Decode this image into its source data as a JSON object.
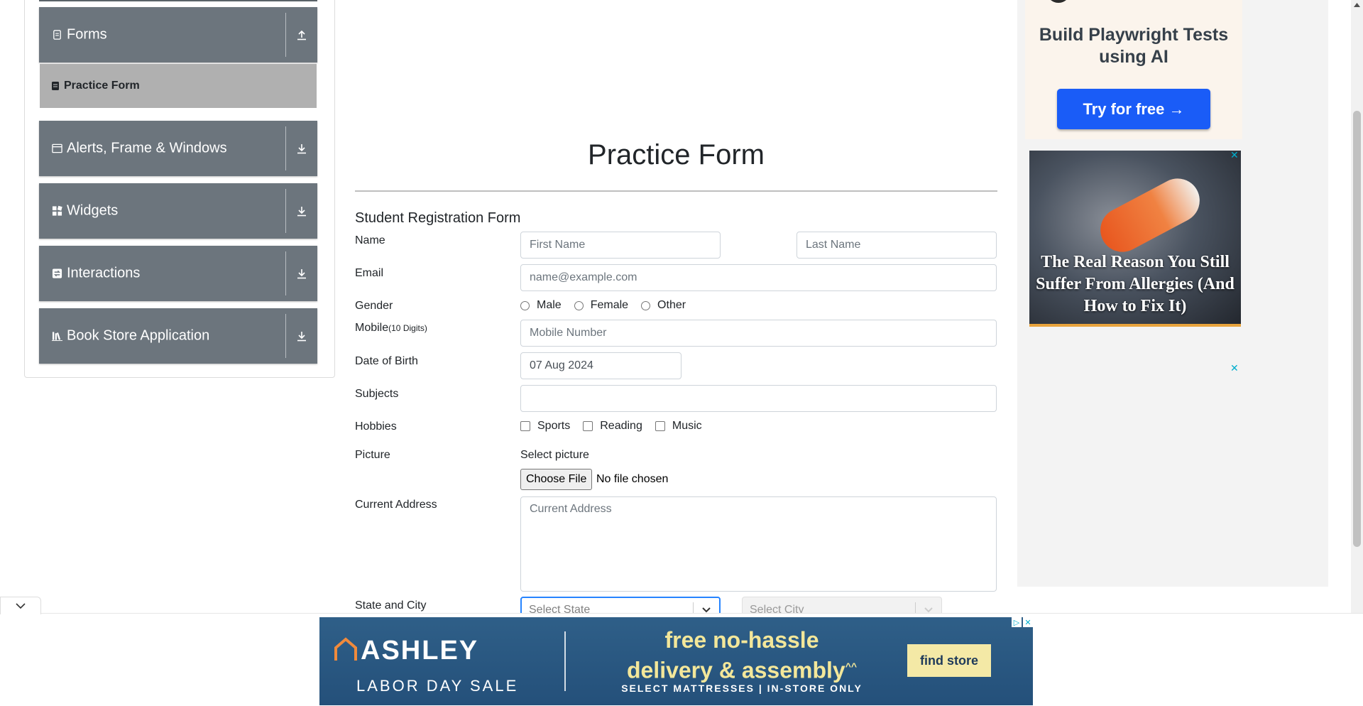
{
  "sidebar": {
    "groups": [
      {
        "label": "Forms",
        "icon": "document-icon",
        "toggle": "up"
      },
      {
        "label": "Alerts, Frame & Windows",
        "icon": "window-icon",
        "toggle": "down"
      },
      {
        "label": "Widgets",
        "icon": "widgets-icon",
        "toggle": "down"
      },
      {
        "label": "Interactions",
        "icon": "interactions-icon",
        "toggle": "down"
      },
      {
        "label": "Book Store Application",
        "icon": "books-icon",
        "toggle": "down"
      }
    ],
    "active_item": "Practice Form"
  },
  "main": {
    "page_title": "Practice Form",
    "form_title": "Student Registration Form",
    "labels": {
      "name": "Name",
      "email": "Email",
      "gender": "Gender",
      "mobile": "Mobile",
      "mobile_hint": "(10 Digits)",
      "dob": "Date of Birth",
      "subjects": "Subjects",
      "hobbies": "Hobbies",
      "picture": "Picture",
      "address": "Current Address",
      "state_city": "State and City"
    },
    "placeholders": {
      "first_name": "First Name",
      "last_name": "Last Name",
      "email": "name@example.com",
      "mobile": "Mobile Number",
      "address": "Current Address",
      "state": "Select State",
      "city": "Select City"
    },
    "dob_value": "07 Aug 2024",
    "gender_options": [
      "Male",
      "Female",
      "Other"
    ],
    "hobby_options": [
      "Sports",
      "Reading",
      "Music"
    ],
    "picture": {
      "select_label": "Select picture",
      "button": "Choose File",
      "status": "No file chosen"
    }
  },
  "ads": {
    "top": {
      "headline": "Build Playwright Tests using AI",
      "button": "Try for free →"
    },
    "middle": {
      "text": "The Real Reason You Still Suffer From Allergies (And How to Fix It)"
    },
    "close": "✕",
    "banner": {
      "brand": "ASHLEY",
      "sale": "LABOR DAY SALE",
      "headline_1": "free no-hassle",
      "headline_2": "delivery & assembly",
      "headline_mark": "^^",
      "sub": "SELECT MATTRESSES | IN-STORE ONLY",
      "button": "find store"
    }
  },
  "colors": {
    "sidebar_group": "#6c757d",
    "active_item": "#b0b0b0",
    "focus_border": "#2684ff",
    "ad_button": "#1a5cf7"
  }
}
